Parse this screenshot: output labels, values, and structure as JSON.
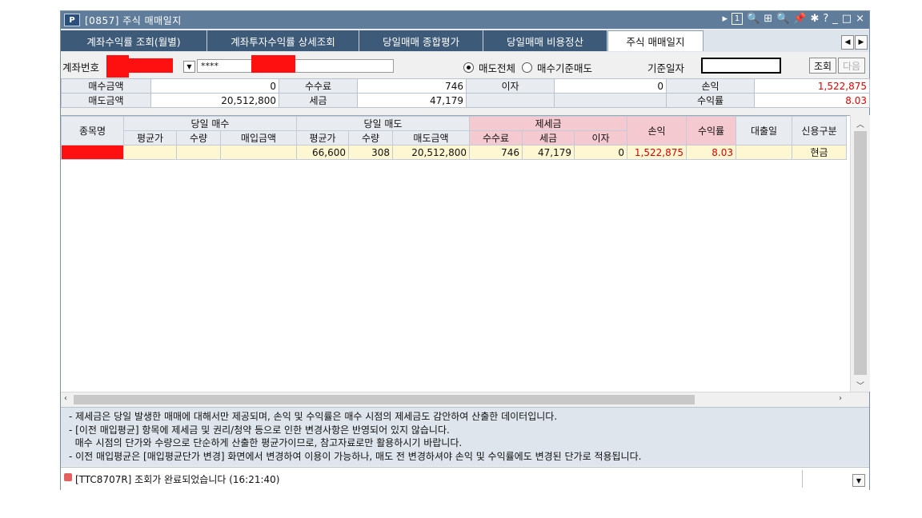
{
  "window": {
    "logo": "P",
    "title": "[0857] 주식 매매일지",
    "titlebar_icons": [
      "▸",
      "1",
      "🔍",
      "⊞",
      "🔍",
      "📌",
      "✱",
      "?",
      "_",
      "□",
      "×"
    ]
  },
  "tabs": [
    {
      "label": "계좌수익률 조회(월별)"
    },
    {
      "label": "계좌투자수익률 상세조회"
    },
    {
      "label": "당일매매 종합평가"
    },
    {
      "label": "당일매매 비용정산"
    },
    {
      "label": "주식 매매일지"
    }
  ],
  "toolbar": {
    "account_label": "계좌번호",
    "password_value": "****",
    "radio_all": "매도전체",
    "radio_basis": "매수기준매도",
    "date_label": "기준일자",
    "query_button": "조회",
    "next_button": "다음"
  },
  "summary": {
    "buy_amount_label": "매수금액",
    "buy_amount": "0",
    "fee_label": "수수료",
    "fee": "746",
    "interest_label": "이자",
    "interest": "0",
    "pl_label": "손익",
    "pl": "1,522,875",
    "sell_amount_label": "매도금액",
    "sell_amount": "20,512,800",
    "tax_label": "세금",
    "tax": "47,179",
    "return_label": "수익률",
    "return": "8.03"
  },
  "grid": {
    "headers": {
      "name": "종목명",
      "buy_group": "당일 매수",
      "sell_group": "당일 매도",
      "tax_group": "제세금",
      "pl": "손익",
      "return": "수익률",
      "loan_date": "대출일",
      "credit": "신용구분",
      "buy_avg": "평균가",
      "buy_qty": "수량",
      "buy_amount": "매입금액",
      "sell_avg": "평균가",
      "sell_qty": "수량",
      "sell_amount": "매도금액",
      "fee": "수수료",
      "tax": "세금",
      "interest": "이자"
    },
    "rows": [
      {
        "name": "",
        "buy_avg": "",
        "buy_qty": "",
        "buy_amount": "",
        "sell_avg": "66,600",
        "sell_qty": "308",
        "sell_amount": "20,512,800",
        "fee": "746",
        "tax": "47,179",
        "interest": "0",
        "pl": "1,522,875",
        "return": "8.03",
        "loan_date": "",
        "credit": "현금"
      }
    ]
  },
  "notes": [
    "- 제세금은 당일 발생한 매매에 대해서만 제공되며,  손익 및 수익률은 매수 시점의 제세금도 감안하여 산출한 데이터입니다.",
    "- [이전 매입평균] 항목에 제세금 및 권리/청약 등으로 인한 변경사항은 반영되어 있지 않습니다.",
    "  매수 시점의 단가와 수량으로 단순하게 산출한 평균가이므로, 참고자료로만 활용하시기 바랍니다.",
    "- 이전 매입평균은 [매입평균단가 변경] 화면에서 변경하여 이용이 가능하나, 매도 전 변경하셔야 손익 및 수익률에도 변경된 단가로 적용됩니다."
  ],
  "status": {
    "message": "[TTC8707R] 조회가 완료되었습니다 (16:21:40)"
  },
  "colors": {
    "titlebar": "#5f7d9b",
    "tab_inactive": "#3d5a78",
    "redaction": "#ff1010",
    "profit_text": "#e00000",
    "row_highlight": "#fff7d1",
    "tax_header": "#f5c9d0"
  }
}
